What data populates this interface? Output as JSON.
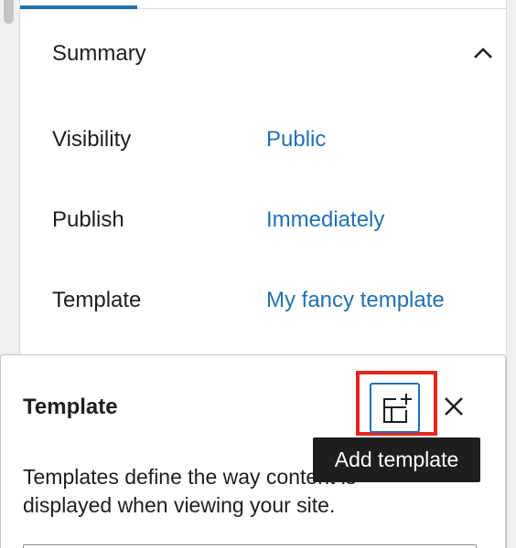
{
  "summary": {
    "title": "Summary",
    "rows": [
      {
        "label": "Visibility",
        "value": "Public"
      },
      {
        "label": "Publish",
        "value": "Immediately"
      },
      {
        "label": "Template",
        "value": "My fancy template"
      }
    ]
  },
  "popover": {
    "title": "Template",
    "add_button_icon": "add-template-icon",
    "close_icon": "close-icon",
    "tooltip": "Add template",
    "description": "Templates define the way content is displayed when viewing your site."
  },
  "colors": {
    "accent": "#2271b1",
    "highlight": "#e8261b",
    "tooltip_bg": "#1e1e1e"
  }
}
